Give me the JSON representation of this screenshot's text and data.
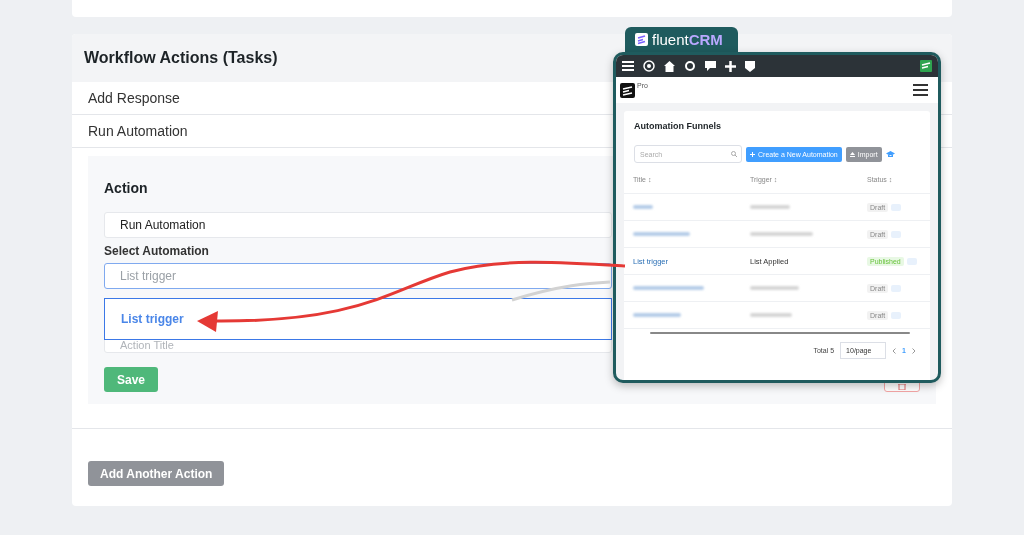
{
  "workflow": {
    "title": "Workflow Actions (Tasks)",
    "items": [
      {
        "label": "Add Response"
      },
      {
        "label": "Run Automation"
      }
    ]
  },
  "action_form": {
    "action_label": "Action",
    "action_value": "Run Automation",
    "select_label": "Select Automation",
    "select_value": "List trigger",
    "dropdown_options": [
      {
        "label": "List trigger",
        "selected": true
      }
    ],
    "title_placeholder": "Action Title",
    "save": "Save"
  },
  "add_another": "Add Another Action",
  "crm": {
    "brand_light": "fluent",
    "brand_bold": "CRM",
    "badge": "Pro",
    "heading": "Automation Funnels",
    "search_placeholder": "Search",
    "create": "Create a New Automation",
    "import": "Import",
    "columns": [
      "Title ↕",
      "Trigger ↕",
      "Status ↕"
    ],
    "rows": [
      {
        "kind": "blurred",
        "status": "Draft",
        "published": false
      },
      {
        "kind": "blurred",
        "status": "Draft",
        "published": false
      },
      {
        "kind": "clear",
        "title": "List trigger",
        "trigger": "List Applied",
        "status": "Published",
        "published": true
      },
      {
        "kind": "blurred",
        "status": "Draft",
        "published": false
      },
      {
        "kind": "blurred",
        "status": "Draft",
        "published": false
      }
    ],
    "total": "Total 5",
    "per_page": "10/page",
    "page": "1"
  }
}
